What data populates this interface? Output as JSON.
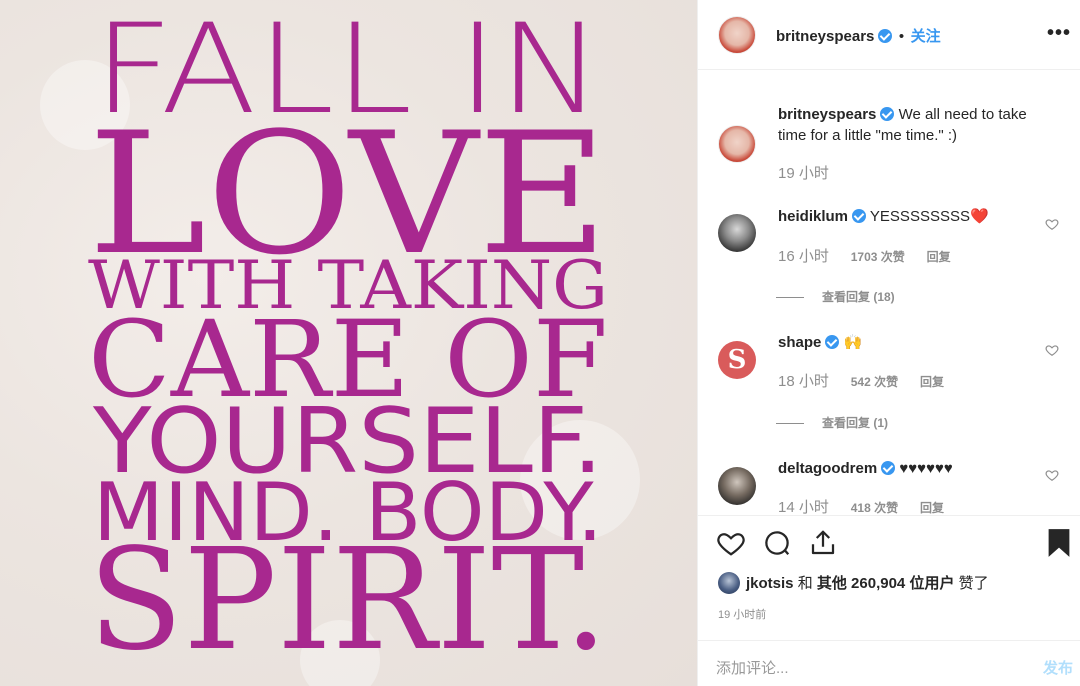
{
  "poster": {
    "line1": "FALL IN",
    "line2": "LOVE",
    "line3": "WITH TAKING",
    "line4": "CARE OF",
    "line5": "YOURSELF.",
    "line6": "MIND. BODY.",
    "line7": "SPIRIT.",
    "text_color": "#a8288f"
  },
  "header": {
    "username": "britneyspears",
    "separator": "•",
    "follow_label": "关注",
    "more_label": "•••"
  },
  "caption": {
    "username": "britneyspears",
    "text": "We all need to take time for a little \"me time.\" :)",
    "time": "19 小时"
  },
  "comments": [
    {
      "username": "heidiklum",
      "text": "YESSSSSSSS❤️",
      "time": "16 小时",
      "likes": "1703 次赞",
      "reply": "回复",
      "view_replies": "查看回复 (18)"
    },
    {
      "username": "shape",
      "text": "🙌",
      "time": "18 小时",
      "likes": "542 次赞",
      "reply": "回复",
      "view_replies": "查看回复 (1)",
      "avatar_letter": "S"
    },
    {
      "username": "deltagoodrem",
      "text": "♥♥♥♥♥♥",
      "time": "14 小时",
      "likes": "418 次赞",
      "reply": "回复"
    }
  ],
  "likes": {
    "user": "jkotsis",
    "and": "和",
    "others": "其他 260,904 位用户",
    "suffix": "赞了"
  },
  "post_time": "19 小时前",
  "add_comment": {
    "placeholder": "添加评论...",
    "publish_label": "发布"
  },
  "colors": {
    "accent_blue": "#3897f0",
    "poster_magenta": "#a8288f",
    "heart_red": "#ed4956"
  },
  "icons": [
    "heart-icon",
    "comment-icon",
    "share-icon",
    "bookmark-icon",
    "verified-icon",
    "more-icon"
  ]
}
